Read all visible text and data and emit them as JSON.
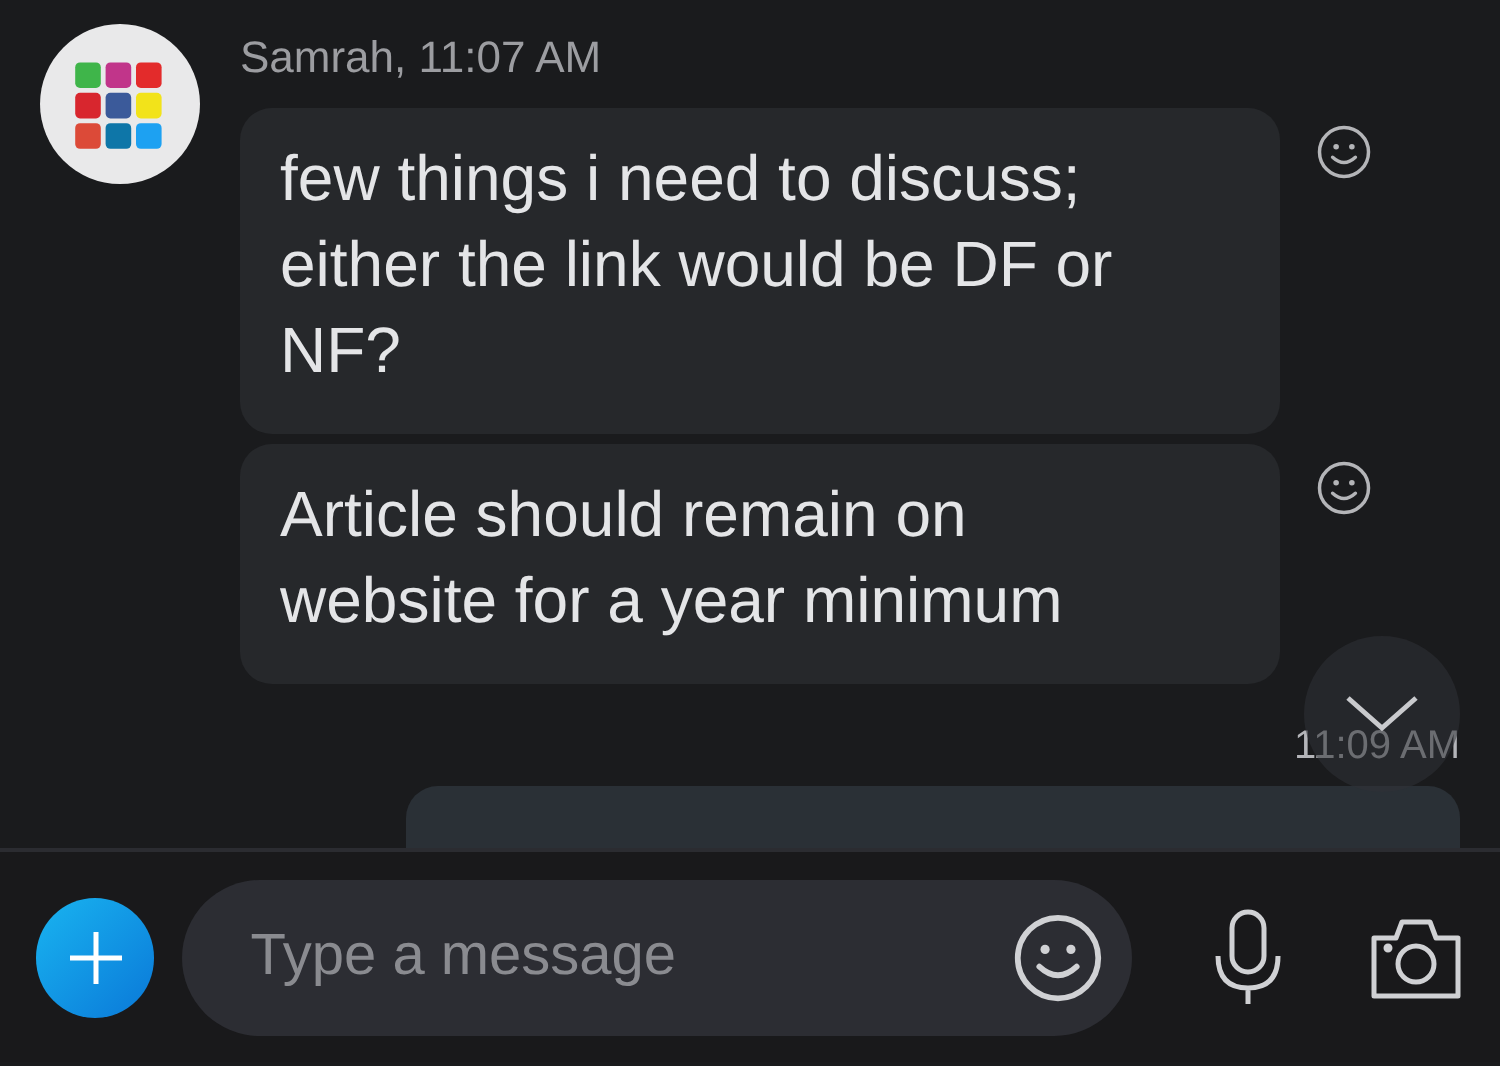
{
  "header": {
    "sender": "Samrah, 11:07 AM"
  },
  "messages": [
    {
      "text": "few things i need to discuss; either the link would be DF or NF?"
    },
    {
      "text": "Article should remain on website for a year minimum"
    }
  ],
  "outgoing": {
    "time": "11:09 AM"
  },
  "composer": {
    "placeholder": "Type a message"
  }
}
